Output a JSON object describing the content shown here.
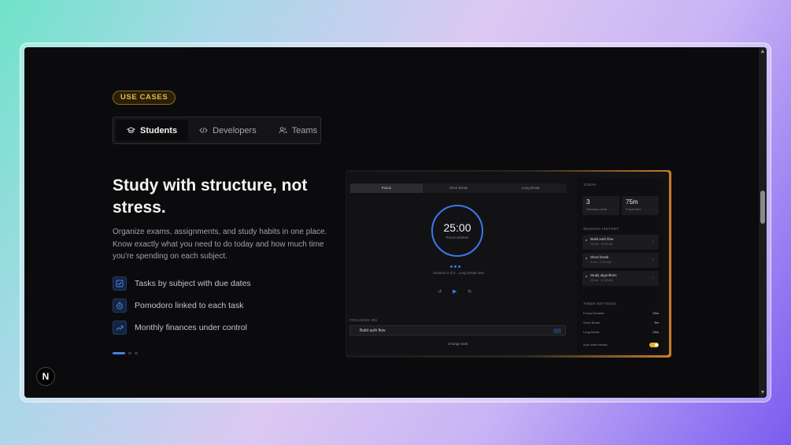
{
  "badge": "USE CASES",
  "tabs": [
    {
      "label": "Students",
      "active": true,
      "icon": "graduation-cap-icon"
    },
    {
      "label": "Developers",
      "active": false,
      "icon": "code-icon"
    },
    {
      "label": "Teams",
      "active": false,
      "icon": "users-icon"
    }
  ],
  "headline": "Study with structure, not stress.",
  "description": "Organize exams, assignments, and study habits in one place. Know exactly what you need to do today and how much time you're spending on each subject.",
  "features": [
    {
      "label": "Tasks by subject with due dates",
      "icon": "checkbox-icon"
    },
    {
      "label": "Pomodoro linked to each task",
      "icon": "timer-icon"
    },
    {
      "label": "Monthly finances under control",
      "icon": "trend-up-icon"
    }
  ],
  "carousel": {
    "active_index": 0,
    "count": 3
  },
  "logo": "N",
  "preview": {
    "tabs": [
      "Focus",
      "Short Break",
      "Long Break"
    ],
    "timer": {
      "time": "25:00",
      "label": "Focus session"
    },
    "session_info": "Session 3 of 4 · Long break next",
    "focus_label": "FOCUSING ON",
    "current_task": "Build auth flow",
    "change_task": "Change task",
    "today_label": "TODAY",
    "stats": [
      {
        "value": "3",
        "label": "Sessions done"
      },
      {
        "value": "75m",
        "label": "Focus time"
      }
    ],
    "history_label": "SESSION HISTORY",
    "history": [
      {
        "title": "Build auth flow",
        "sub": "25 min · 10:00 AM"
      },
      {
        "title": "Short break",
        "sub": "5 min · 10:25 AM"
      },
      {
        "title": "Study algorithms",
        "sub": "25 min · 10:30 AM"
      }
    ],
    "settings_label": "TIMER SETTINGS",
    "settings": [
      {
        "label": "Focus Duration",
        "value": "25m"
      },
      {
        "label": "Short Break",
        "value": "5m"
      },
      {
        "label": "Long Break",
        "value": "15m"
      }
    ],
    "auto_start": {
      "label": "Auto-start breaks",
      "on": true
    }
  },
  "colors": {
    "accent": "#3c78e8",
    "badge": "#e8b84a",
    "background": "#0b0b0d"
  }
}
